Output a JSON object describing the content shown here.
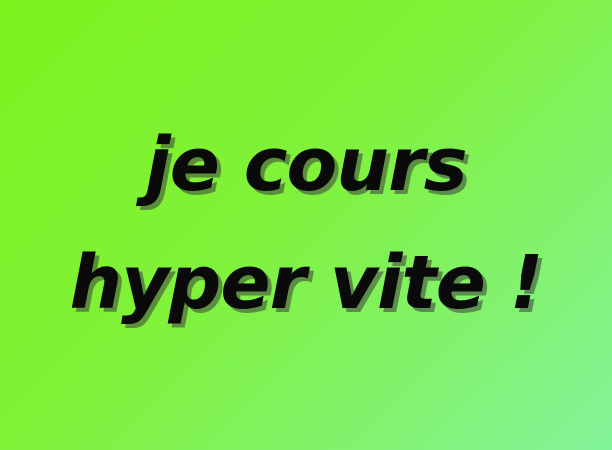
{
  "caption": {
    "line1": "je cours",
    "line2": "hyper vite !"
  },
  "colors": {
    "background_start": "#7cf21c",
    "background_end": "#83f39a",
    "text": "#0a0a0a",
    "shadow": "#3c3c3c"
  }
}
